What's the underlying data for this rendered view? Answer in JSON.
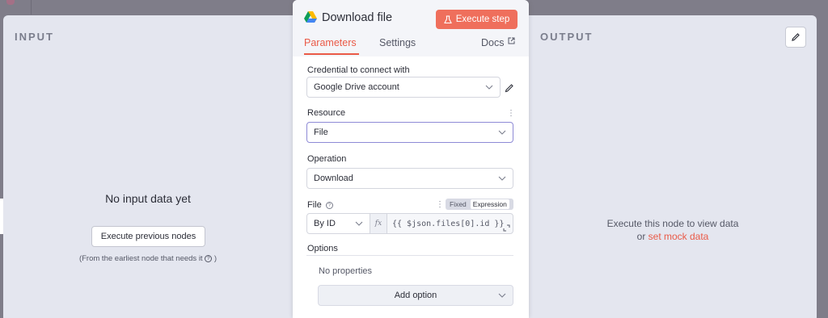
{
  "node": {
    "title": "Download file",
    "execute_step_label": "Execute step"
  },
  "tabs": {
    "parameters": "Parameters",
    "settings": "Settings",
    "docs": "Docs"
  },
  "input_pane": {
    "title": "INPUT",
    "empty_message": "No input data yet",
    "execute_previous_label": "Execute previous nodes",
    "note_prefix": "(From the earliest node that needs it",
    "note_suffix": ")"
  },
  "output_pane": {
    "title": "OUTPUT",
    "hint_line1": "Execute this node to view data",
    "hint_or": "or",
    "mock_link": "set mock data"
  },
  "params": {
    "credential_label": "Credential to connect with",
    "credential_value": "Google Drive account",
    "resource_label": "Resource",
    "resource_value": "File",
    "operation_label": "Operation",
    "operation_value": "Download",
    "file_label": "File",
    "file_mode_fixed": "Fixed",
    "file_mode_expression": "Expression",
    "file_by": "By ID",
    "fx_label": "fx",
    "file_expression": "{{ $json.files[0].id }}",
    "options_label": "Options",
    "no_properties": "No properties",
    "add_option_label": "Add option"
  },
  "colors": {
    "accent": "#ea5a47",
    "execute_button": "#ef6f5c",
    "panel_bg": "#e4e6ef"
  }
}
